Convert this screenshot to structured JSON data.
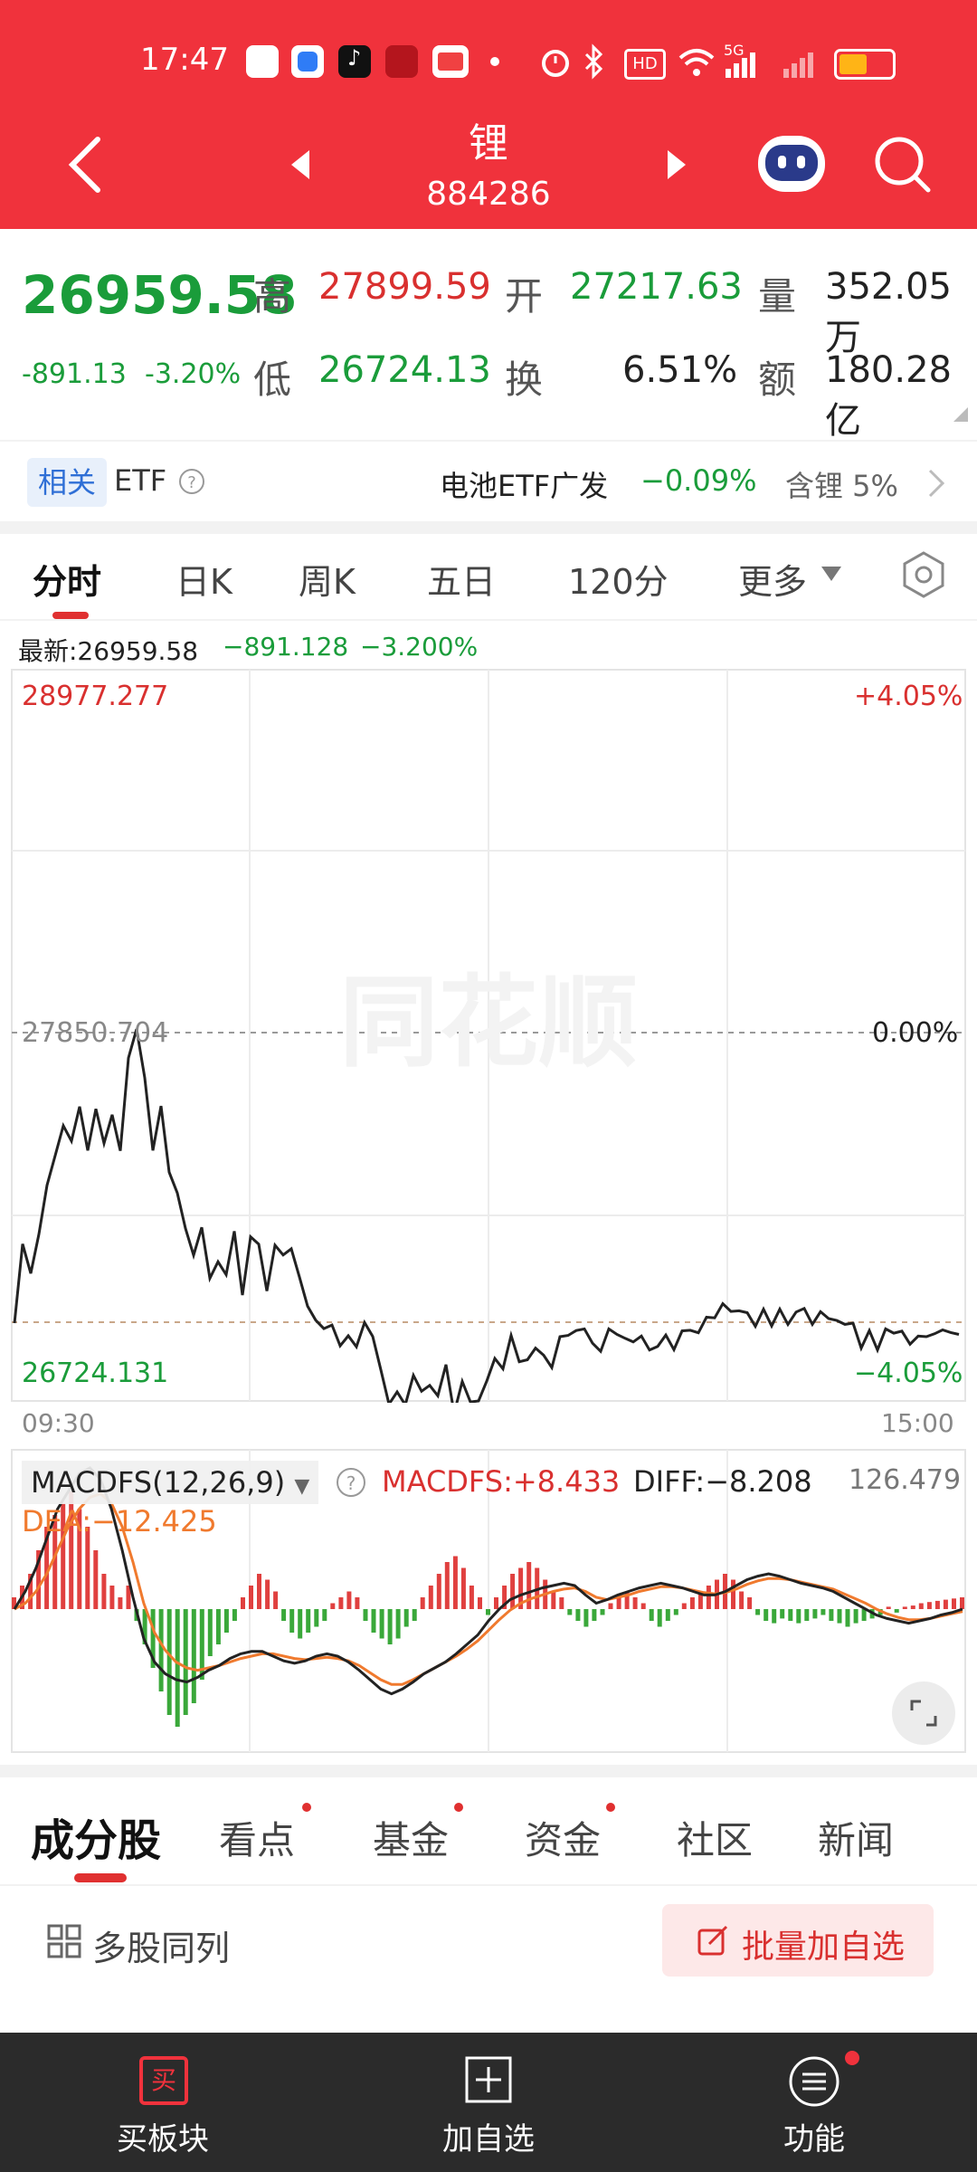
{
  "status_bar": {
    "time": "17:47",
    "network": "5G"
  },
  "header": {
    "name": "锂",
    "code": "884286"
  },
  "quote": {
    "price": "26959.58",
    "change": "-891.13",
    "change_pct": "-3.20%",
    "high_label": "高",
    "high": "27899.59",
    "low_label": "低",
    "low": "26724.13",
    "open_label": "开",
    "open": "27217.63",
    "turnover_label": "换",
    "turnover": "6.51%",
    "volume_label": "量",
    "volume": "352.05万",
    "amount_label": "额",
    "amount": "180.28亿"
  },
  "etf_bar": {
    "tag": "相关",
    "etf_label": "ETF",
    "fund_name": "电池ETF广发",
    "fund_change": "−0.09%",
    "holding": "含锂 5%"
  },
  "chart_tabs": [
    "分时",
    "日K",
    "周K",
    "五日",
    "120分",
    "更多"
  ],
  "chart_info": {
    "latest": "最新:26959.58",
    "diff": "−891.128",
    "pct": "−3.200%"
  },
  "chart_labels": {
    "top_price": "28977.277",
    "top_pct": "+4.05%",
    "mid_price": "27850.704",
    "mid_pct": "0.00%",
    "bottom_price": "26724.131",
    "bottom_pct": "−4.05%",
    "start_time": "09:30",
    "end_time": "15:00",
    "watermark": "同花顺"
  },
  "macd": {
    "selector": "MACDFS(12,26,9)",
    "macdfs": "MACDFS:+8.433",
    "diff": "DIFF:−8.208",
    "dea": "DEA:−12.425",
    "max": "126.479"
  },
  "bottom_tabs": [
    {
      "label": "成分股",
      "dot": false
    },
    {
      "label": "看点",
      "dot": true
    },
    {
      "label": "基金",
      "dot": true
    },
    {
      "label": "资金",
      "dot": true
    },
    {
      "label": "社区",
      "dot": false
    },
    {
      "label": "新闻",
      "dot": false
    }
  ],
  "list_header": {
    "multi_label": "多股同列",
    "batch_label": "批量加自选"
  },
  "bottom_bar": {
    "buy_label": "买板块",
    "buy_icon_text": "买",
    "add_label": "加自选",
    "func_label": "功能"
  },
  "chart_data": {
    "type": "line",
    "title": "",
    "x_range": [
      "09:30",
      "15:00"
    ],
    "ylim": [
      26724.131,
      28977.277
    ],
    "baseline": 27850.704,
    "series": [
      {
        "values": [
          26964,
          27208,
          27117,
          27238,
          27389,
          27480,
          27572,
          27525,
          27631,
          27496,
          27624,
          27518,
          27606,
          27495,
          27781,
          27870,
          27720,
          27496,
          27633,
          27429,
          27365,
          27256,
          27173,
          27259,
          27102,
          27153,
          27113,
          27247,
          27050,
          27230,
          27207,
          27063,
          27204,
          27174,
          27193,
          27106,
          27016,
          26973,
          26947,
          26958,
          26894,
          26925,
          26891,
          26966,
          26923,
          26820,
          26714,
          26752,
          26712,
          26803,
          26754,
          26772,
          26740,
          26836,
          26686,
          26784,
          26721,
          26724,
          26785,
          26855,
          26823,
          26926,
          26845,
          26851,
          26887,
          26865,
          26827,
          26922,
          26926,
          26941,
          26946,
          26902,
          26877,
          26946,
          26929,
          26917,
          26906,
          26924,
          26881,
          26892,
          26927,
          26882,
          26940,
          26942,
          26934,
          26982,
          26980,
          27024,
          27000,
          27002,
          26996,
          26954,
          27007,
          26955,
          27007,
          26960,
          26998,
          27009,
          26960,
          26999,
          26978,
          26972,
          26960,
          26964,
          26887,
          26941,
          26881,
          26946,
          26933,
          26939,
          26899,
          26924,
          26922,
          26931,
          26943,
          26935,
          26929
        ]
      }
    ],
    "macd": {
      "values": [
        0.1,
        0.2,
        0.3,
        0.5,
        0.7,
        0.8,
        0.9,
        1.0,
        0.85,
        0.7,
        0.5,
        0.3,
        0.2,
        0.1,
        0.2,
        -0.1,
        -0.3,
        -0.5,
        -0.7,
        -0.9,
        -1.0,
        -0.9,
        -0.8,
        -0.6,
        -0.4,
        -0.3,
        -0.2,
        -0.1,
        0.1,
        0.2,
        0.3,
        0.25,
        0.15,
        -0.1,
        -0.2,
        -0.25,
        -0.2,
        -0.15,
        -0.1,
        0.05,
        0.1,
        0.15,
        0.1,
        -0.1,
        -0.2,
        -0.25,
        -0.3,
        -0.25,
        -0.15,
        -0.1,
        0.1,
        0.2,
        0.3,
        0.4,
        0.45,
        0.35,
        0.2,
        0.1,
        -0.05,
        0.1,
        0.2,
        0.3,
        0.35,
        0.4,
        0.35,
        0.25,
        0.15,
        0.1,
        -0.05,
        -0.1,
        -0.15,
        -0.1,
        -0.05,
        0.05,
        0.1,
        0.15,
        0.1,
        0.05,
        -0.1,
        -0.15,
        -0.1,
        -0.05,
        0.05,
        0.1,
        0.15,
        0.2,
        0.25,
        0.3,
        0.25,
        0.15,
        0.1,
        -0.05,
        -0.1,
        -0.12,
        -0.08,
        -0.1,
        -0.12,
        -0.1,
        -0.08,
        -0.05,
        -0.1,
        -0.12,
        -0.15,
        -0.12,
        -0.1,
        -0.08,
        -0.05,
        0.02,
        -0.03,
        0.02,
        0.03,
        0.05,
        0.06,
        0.07,
        0.08,
        0.09,
        0.1
      ],
      "diff": [
        0.0,
        0.15,
        0.35,
        0.6,
        0.85,
        1.0,
        1.15,
        1.2,
        1.1,
        0.85,
        0.5,
        0.1,
        -0.25,
        -0.45,
        -0.55,
        -0.6,
        -0.62,
        -0.58,
        -0.52,
        -0.48,
        -0.42,
        -0.38,
        -0.36,
        -0.36,
        -0.4,
        -0.44,
        -0.46,
        -0.44,
        -0.4,
        -0.38,
        -0.4,
        -0.45,
        -0.52,
        -0.6,
        -0.68,
        -0.72,
        -0.68,
        -0.62,
        -0.55,
        -0.5,
        -0.45,
        -0.38,
        -0.3,
        -0.22,
        -0.1,
        0.0,
        0.08,
        0.12,
        0.15,
        0.18,
        0.2,
        0.22,
        0.2,
        0.12,
        0.05,
        0.08,
        0.12,
        0.15,
        0.18,
        0.2,
        0.22,
        0.2,
        0.18,
        0.15,
        0.12,
        0.12,
        0.15,
        0.2,
        0.25,
        0.28,
        0.3,
        0.28,
        0.25,
        0.22,
        0.2,
        0.18,
        0.15,
        0.1,
        0.05,
        0.0,
        -0.05,
        -0.08,
        -0.1,
        -0.12,
        -0.1,
        -0.08,
        -0.05,
        -0.03,
        0.0
      ],
      "dea": [
        0.0,
        0.05,
        0.15,
        0.3,
        0.5,
        0.7,
        0.85,
        0.95,
        0.98,
        0.9,
        0.7,
        0.4,
        0.05,
        -0.2,
        -0.35,
        -0.45,
        -0.5,
        -0.52,
        -0.5,
        -0.48,
        -0.45,
        -0.42,
        -0.4,
        -0.38,
        -0.38,
        -0.4,
        -0.42,
        -0.43,
        -0.42,
        -0.41,
        -0.42,
        -0.44,
        -0.48,
        -0.54,
        -0.6,
        -0.64,
        -0.64,
        -0.6,
        -0.55,
        -0.5,
        -0.45,
        -0.4,
        -0.34,
        -0.27,
        -0.18,
        -0.09,
        -0.01,
        0.05,
        0.09,
        0.12,
        0.15,
        0.17,
        0.18,
        0.15,
        0.1,
        0.08,
        0.1,
        0.12,
        0.15,
        0.17,
        0.19,
        0.19,
        0.18,
        0.16,
        0.14,
        0.13,
        0.14,
        0.17,
        0.21,
        0.24,
        0.26,
        0.26,
        0.25,
        0.23,
        0.21,
        0.19,
        0.17,
        0.13,
        0.09,
        0.05,
        0.0,
        -0.04,
        -0.07,
        -0.09,
        -0.09,
        -0.08,
        -0.06,
        -0.04,
        -0.02
      ]
    }
  },
  "colors": {
    "brand_red": "#F0323C",
    "down_green": "#1a9c3a",
    "up_red": "#d9302f"
  }
}
